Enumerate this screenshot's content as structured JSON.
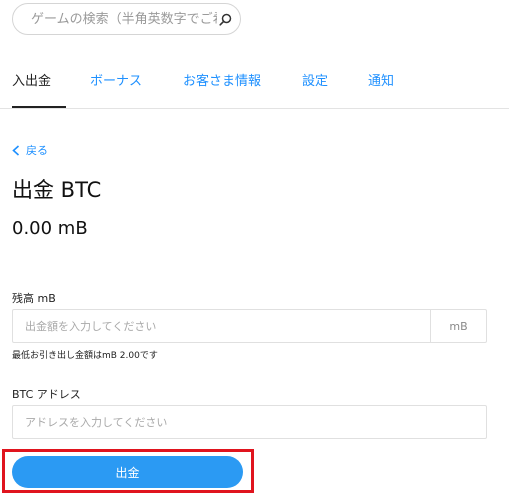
{
  "search": {
    "placeholder": "ゲームの検索（半角英数字でご希"
  },
  "tabs": [
    {
      "label": "入出金",
      "active": true
    },
    {
      "label": "ボーナス",
      "active": false
    },
    {
      "label": "お客さま情報",
      "active": false
    },
    {
      "label": "設定",
      "active": false
    },
    {
      "label": "通知",
      "active": false
    }
  ],
  "back": {
    "label": "戻る"
  },
  "page": {
    "title": "出金 BTC",
    "balance": "0.00 mB"
  },
  "form": {
    "amount_label": "残高 mB",
    "amount_placeholder": "出金額を入力してください",
    "amount_unit": "mB",
    "min_note": "最低お引き出し金額はmB 2.00です",
    "address_label": "BTC アドレス",
    "address_placeholder": "アドレスを入力してください",
    "submit_label": "出金"
  },
  "colors": {
    "accent": "#1e90ff",
    "button": "#2b9af3",
    "highlight": "#e0141e"
  }
}
